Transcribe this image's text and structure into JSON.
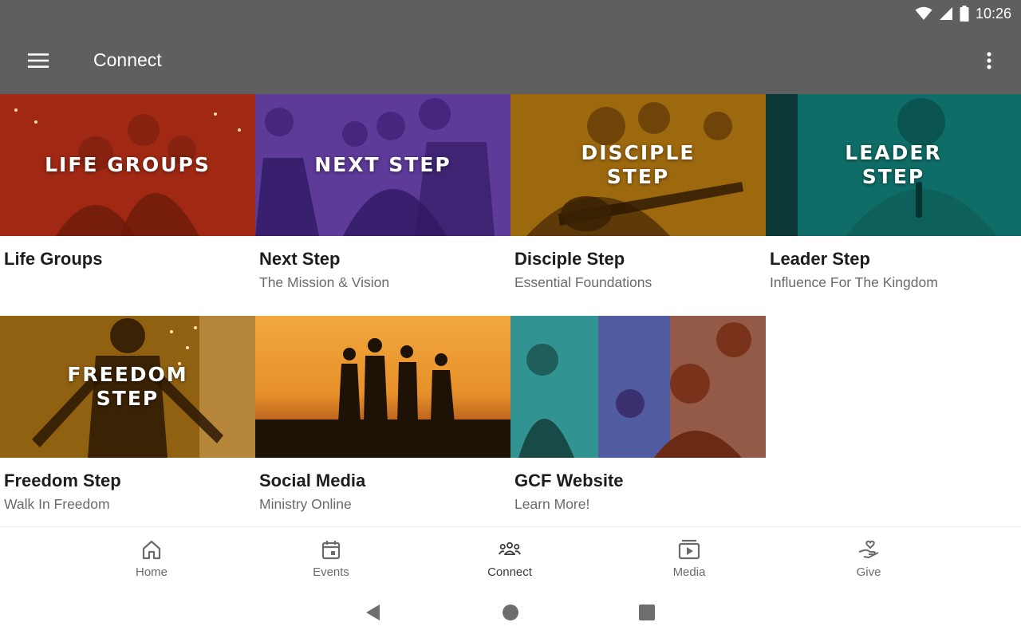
{
  "status": {
    "time": "10:26"
  },
  "appbar": {
    "title": "Connect",
    "menu_icon": "hamburger-menu-icon",
    "overflow_icon": "more-vert-icon"
  },
  "cards": [
    {
      "overlay": [
        "LIFE GROUPS"
      ],
      "title": "Life Groups",
      "subtitle": "",
      "tint": "#c8361a"
    },
    {
      "overlay": [
        "NEXT STEP"
      ],
      "title": "Next Step",
      "subtitle": "The Mission & Vision",
      "tint": "#7a4fc0"
    },
    {
      "overlay": [
        "DISCIPLE",
        "STEP"
      ],
      "title": "Disciple Step",
      "subtitle": "Essential Foundations",
      "tint": "#c98a14"
    },
    {
      "overlay": [
        "LEADER",
        "STEP"
      ],
      "title": "Leader Step",
      "subtitle": "Influence For The Kingdom",
      "tint": "#117f7a"
    },
    {
      "overlay": [
        "FREEDOM",
        "STEP"
      ],
      "title": "Freedom Step",
      "subtitle": "Walk In Freedom",
      "tint": "#c9891c"
    },
    {
      "overlay": [],
      "title": "Social Media",
      "subtitle": "Ministry Online",
      "tint": "#e7902a"
    },
    {
      "overlay": [],
      "title": "GCF Website",
      "subtitle": "Learn More!",
      "tint": "#3e7ea0"
    }
  ],
  "bottom_nav": [
    {
      "label": "Home",
      "icon": "home-icon"
    },
    {
      "label": "Events",
      "icon": "calendar-icon"
    },
    {
      "label": "Connect",
      "icon": "people-group-icon",
      "active": true
    },
    {
      "label": "Media",
      "icon": "video-play-icon"
    },
    {
      "label": "Give",
      "icon": "hand-heart-icon"
    }
  ]
}
